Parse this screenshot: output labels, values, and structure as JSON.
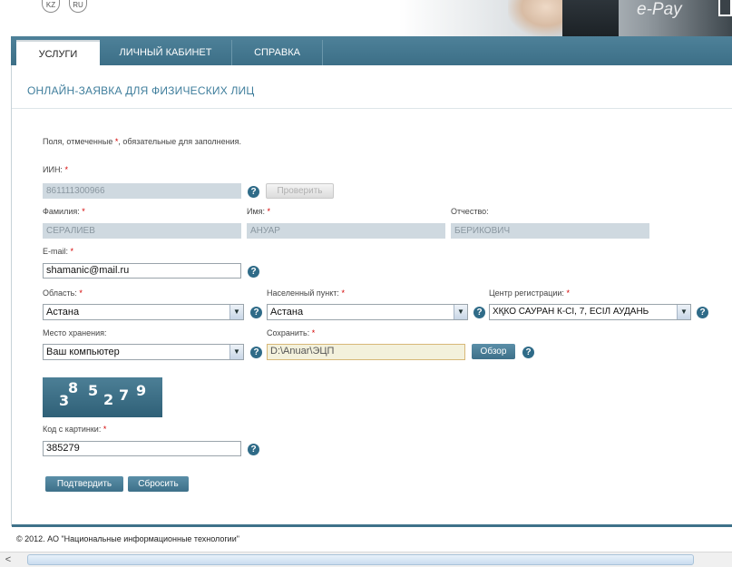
{
  "header": {
    "languages": [
      "KZ",
      "RU"
    ],
    "banner_text": "e-Pay"
  },
  "nav": {
    "tabs": [
      {
        "label": "УСЛУГИ",
        "active": true
      },
      {
        "label": "ЛИЧНЫЙ КАБИНЕТ",
        "active": false
      },
      {
        "label": "СПРАВКА",
        "active": false
      }
    ]
  },
  "page": {
    "title": "ОНЛАЙН-ЗАЯВКА ДЛЯ ФИЗИЧЕСКИХ ЛИЦ",
    "note_before": "Поля, отмеченные ",
    "note_star": "*",
    "note_after": ", обязательные для заполнения."
  },
  "form": {
    "required_mark": "*",
    "help_glyph": "?",
    "select_arrow": "▼",
    "iin": {
      "label": "ИИН:",
      "value": "861111300966",
      "check_button": "Проверить"
    },
    "surname": {
      "label": "Фамилия:",
      "value": "СЕРАЛИЕВ"
    },
    "name": {
      "label": "Имя:",
      "value": "АНУАР"
    },
    "patronymic": {
      "label": "Отчество:",
      "value": "БЕРИКОВИЧ"
    },
    "email": {
      "label": "E-mail:",
      "value": "shamanic@mail.ru"
    },
    "region": {
      "label": "Область:",
      "value": "Астана"
    },
    "locality": {
      "label": "Населенный пункт:",
      "value": "Астана"
    },
    "reg_center": {
      "label": "Центр регистрации:",
      "value": "ХҚКО САУРАН К-СІ, 7, ЕСІЛ АУДАНЬ"
    },
    "storage": {
      "label": "Место хранения:",
      "value": "Ваш компьютер"
    },
    "save_path": {
      "label": "Сохранить:",
      "value": "D:\\Anuar\\ЭЦП",
      "browse_button": "Обзор"
    },
    "captcha": {
      "digits": [
        "3",
        "8",
        "5",
        "2",
        "7",
        "9"
      ]
    },
    "captcha_code": {
      "label": "Код с картинки:",
      "value": "385279"
    },
    "confirm_button": "Подтвердить",
    "reset_button": "Сбросить"
  },
  "footer": {
    "copyright": "© 2012. АО \"Национальные информационные технологии\""
  },
  "scrollbar": {
    "left_arrow": "<"
  }
}
